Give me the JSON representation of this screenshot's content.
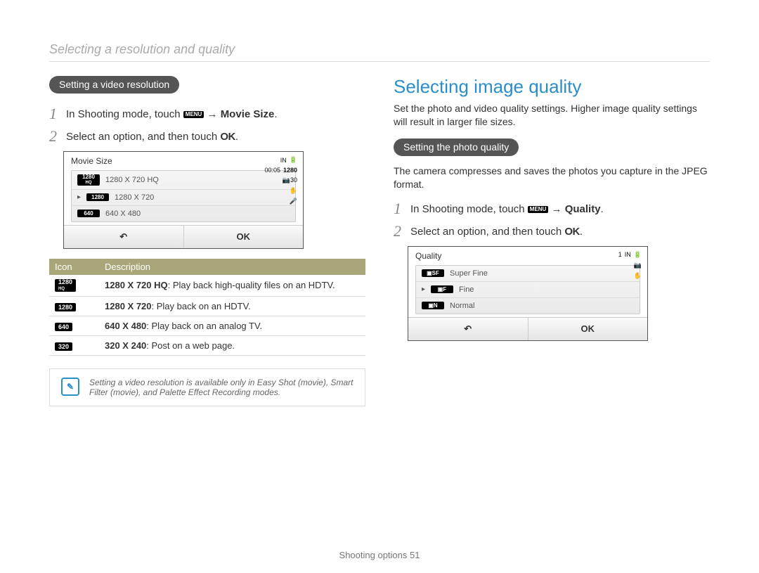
{
  "pageHeader": "Selecting a resolution and quality",
  "left": {
    "pill": "Setting a video resolution",
    "step1_a": "In Shooting mode, touch ",
    "step1_menu": "MENU",
    "step1_b": " → ",
    "step1_bold": "Movie Size",
    "step1_c": ".",
    "step2_a": "Select an option, and then touch ",
    "step2_ok": "OK",
    "step2_c": ".",
    "screen": {
      "title": "Movie Size",
      "timer": "00:05",
      "mode": "1280",
      "icons": [
        "IN",
        "🔳",
        "📷30",
        "✋",
        "🎤"
      ],
      "options": [
        {
          "badge": "1280\nHQ",
          "label": "1280 X 720 HQ",
          "sel": false
        },
        {
          "badge": "1280",
          "label": "1280 X 720",
          "sel": true
        },
        {
          "badge": "640",
          "label": "640 X 480",
          "sel": false
        }
      ],
      "back": "↶",
      "ok": "OK"
    },
    "table": {
      "h1": "Icon",
      "h2": "Description",
      "rows": [
        {
          "ic": "1280\nHQ",
          "bold": "1280 X 720 HQ",
          "rest": ": Play back high-quality files on an HDTV."
        },
        {
          "ic": "1280",
          "bold": "1280 X 720",
          "rest": ": Play back on an HDTV."
        },
        {
          "ic": "640",
          "bold": "640 X 480",
          "rest": ": Play back on an analog TV."
        },
        {
          "ic": "320",
          "bold": "320 X 240",
          "rest": ": Post on a web page."
        }
      ]
    },
    "note": "Setting a video resolution is available only in Easy Shot (movie), Smart Filter (movie), and Palette Effect Recording modes."
  },
  "right": {
    "title": "Selecting image quality",
    "intro": "Set the photo and video quality settings. Higher image quality settings will result in larger file sizes.",
    "pill": "Setting the photo quality",
    "para": "The camera compresses and saves the photos you capture in the JPEG format.",
    "step1_a": "In Shooting mode, touch ",
    "step1_menu": "MENU",
    "step1_b": " → ",
    "step1_bold": "Quality",
    "step1_c": ".",
    "step2_a": "Select an option, and then touch ",
    "step2_ok": "OK",
    "step2_c": ".",
    "screen": {
      "title": "Quality",
      "counter": "1",
      "icons": [
        "IN",
        "🔳",
        "📷",
        "✋"
      ],
      "options": [
        {
          "badge": "SF",
          "label": "Super Fine",
          "sel": false
        },
        {
          "badge": "F",
          "label": "Fine",
          "sel": true
        },
        {
          "badge": "N",
          "label": "Normal",
          "sel": false
        }
      ],
      "back": "↶",
      "ok": "OK"
    }
  },
  "footer_a": "Shooting options  ",
  "footer_b": "51"
}
